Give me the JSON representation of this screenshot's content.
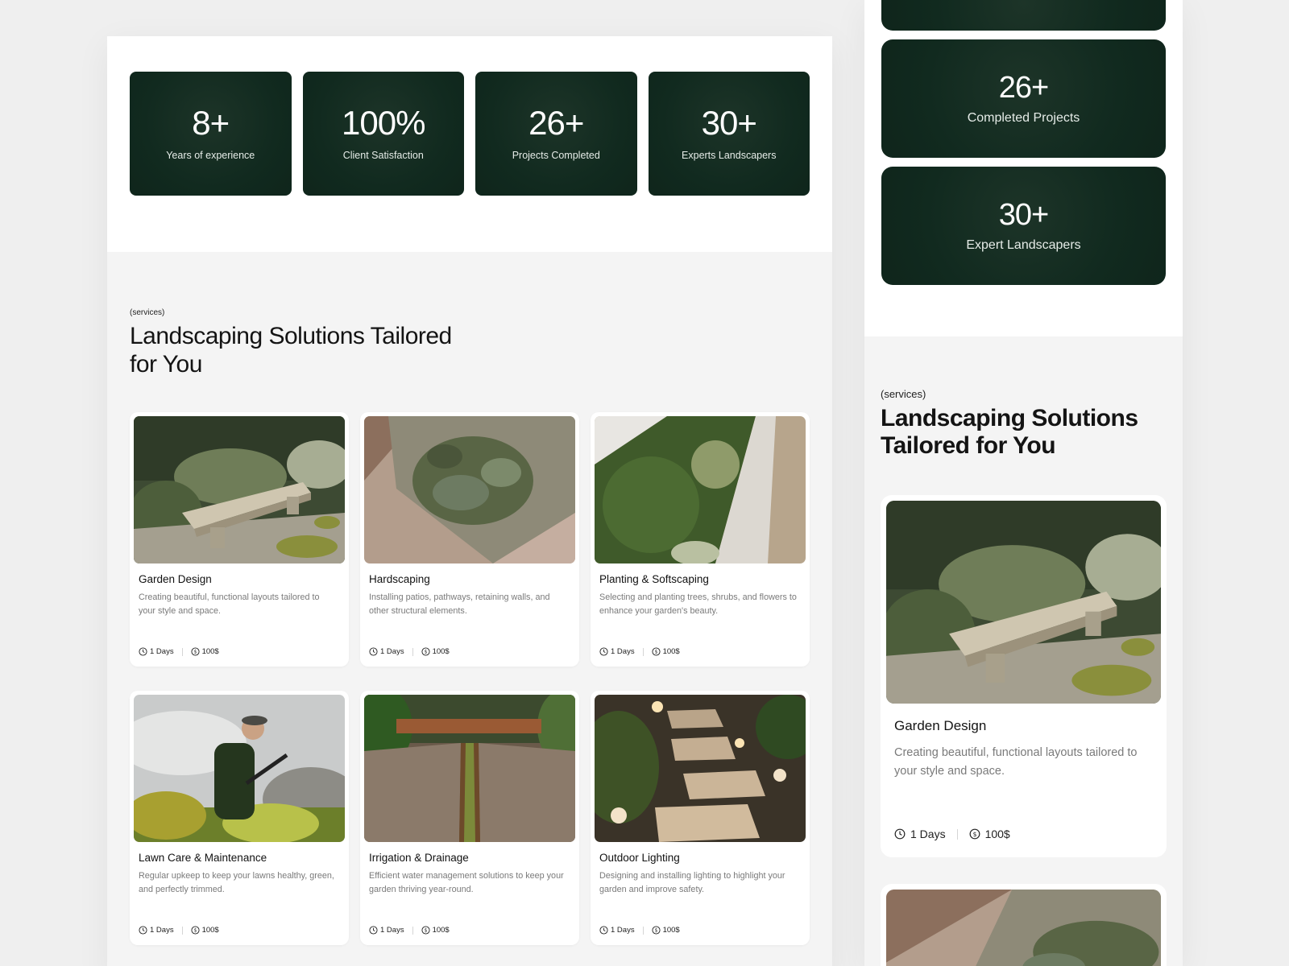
{
  "desktop": {
    "stats": [
      {
        "value": "8+",
        "label": "Years of experience"
      },
      {
        "value": "100%",
        "label": "Client Satisfaction"
      },
      {
        "value": "26+",
        "label": "Projects Completed"
      },
      {
        "value": "30+",
        "label": "Experts Landscapers"
      }
    ],
    "services": {
      "eyebrow": "(services)",
      "heading": "Landscaping Solutions Tailored for You",
      "cards": [
        {
          "title": "Garden Design",
          "desc": "Creating beautiful, functional layouts tailored to your style and space.",
          "duration": "1 Days",
          "price": "100$",
          "image": "bench-garden-photo"
        },
        {
          "title": "Hardscaping",
          "desc": "Installing patios, pathways, retaining walls, and other structural elements.",
          "duration": "1 Days",
          "price": "100$",
          "image": "patio-planting-photo"
        },
        {
          "title": "Planting & Softscaping",
          "desc": "Selecting and planting trees, shrubs, and flowers to enhance your garden's beauty.",
          "duration": "1 Days",
          "price": "100$",
          "image": "shrubs-gravel-photo"
        },
        {
          "title": "Lawn Care & Maintenance",
          "desc": "Regular upkeep to keep your lawns healthy, green, and perfectly trimmed.",
          "duration": "1 Days",
          "price": "100$",
          "image": "gardener-photo"
        },
        {
          "title": "Irrigation & Drainage",
          "desc": "Efficient water management solutions to keep your garden thriving year-round.",
          "duration": "1 Days",
          "price": "100$",
          "image": "water-channel-photo"
        },
        {
          "title": "Outdoor Lighting",
          "desc": "Designing and installing lighting to highlight your garden and improve safety.",
          "duration": "1 Days",
          "price": "100$",
          "image": "lit-path-photo"
        }
      ]
    }
  },
  "mobile": {
    "stats": [
      {
        "value": "26+",
        "label": "Completed Projects"
      },
      {
        "value": "30+",
        "label": "Expert Landscapers"
      }
    ],
    "services": {
      "eyebrow": "(services)",
      "heading": "Landscaping Solutions Tailored for You",
      "card": {
        "title": "Garden Design",
        "desc": "Creating beautiful, functional layouts tailored to your style and space.",
        "duration": "1 Days",
        "price": "100$"
      }
    }
  },
  "colors": {
    "card_green": "#112a1f",
    "page_bg": "#f4f4f4"
  },
  "icons": [
    "clock-icon",
    "coin-icon"
  ]
}
